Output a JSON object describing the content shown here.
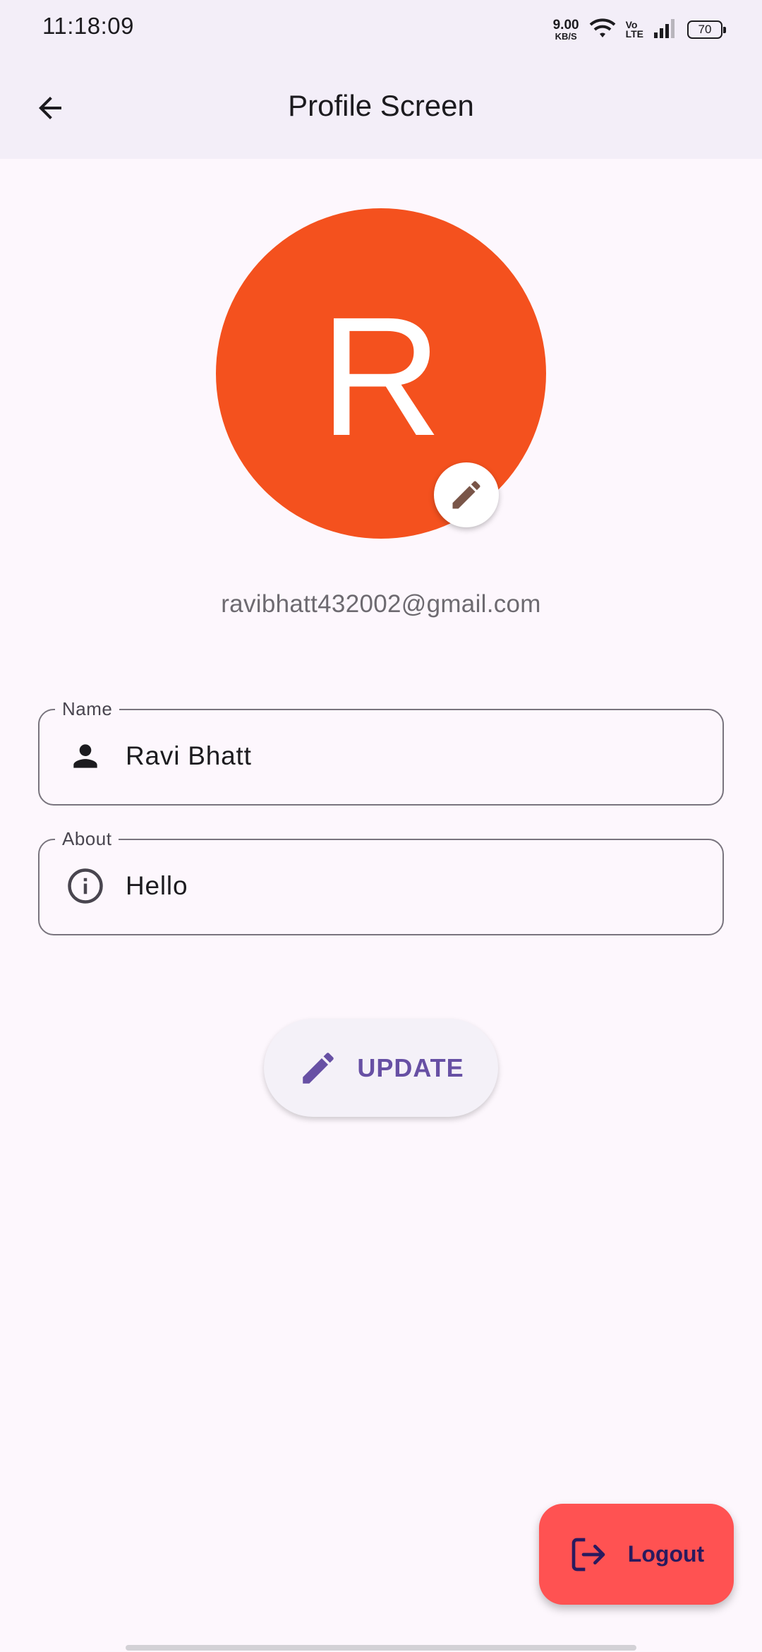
{
  "status_bar": {
    "time": "11:18:09",
    "net_speed_value": "9.00",
    "net_speed_unit": "KB/S",
    "volte_top": "Vo",
    "volte_bottom": "LTE",
    "battery": "70",
    "icons": [
      "wifi-icon",
      "volte-icon",
      "signal-icon",
      "battery-icon"
    ]
  },
  "app_bar": {
    "title": "Profile Screen",
    "back_icon": "arrow-back-icon"
  },
  "profile": {
    "avatar_letter": "R",
    "avatar_color": "#f4511e",
    "email": "ravibhatt432002@gmail.com",
    "edit_icon": "pencil-icon"
  },
  "fields": {
    "name": {
      "label": "Name",
      "value": "Ravi Bhatt",
      "icon": "person-icon"
    },
    "about": {
      "label": "About",
      "value": "Hello",
      "icon": "info-icon"
    }
  },
  "update_button": {
    "label": "UPDATE",
    "icon": "pencil-icon",
    "color": "#6750a4"
  },
  "logout_button": {
    "label": "Logout",
    "icon": "logout-icon",
    "color": "#ff5252"
  }
}
